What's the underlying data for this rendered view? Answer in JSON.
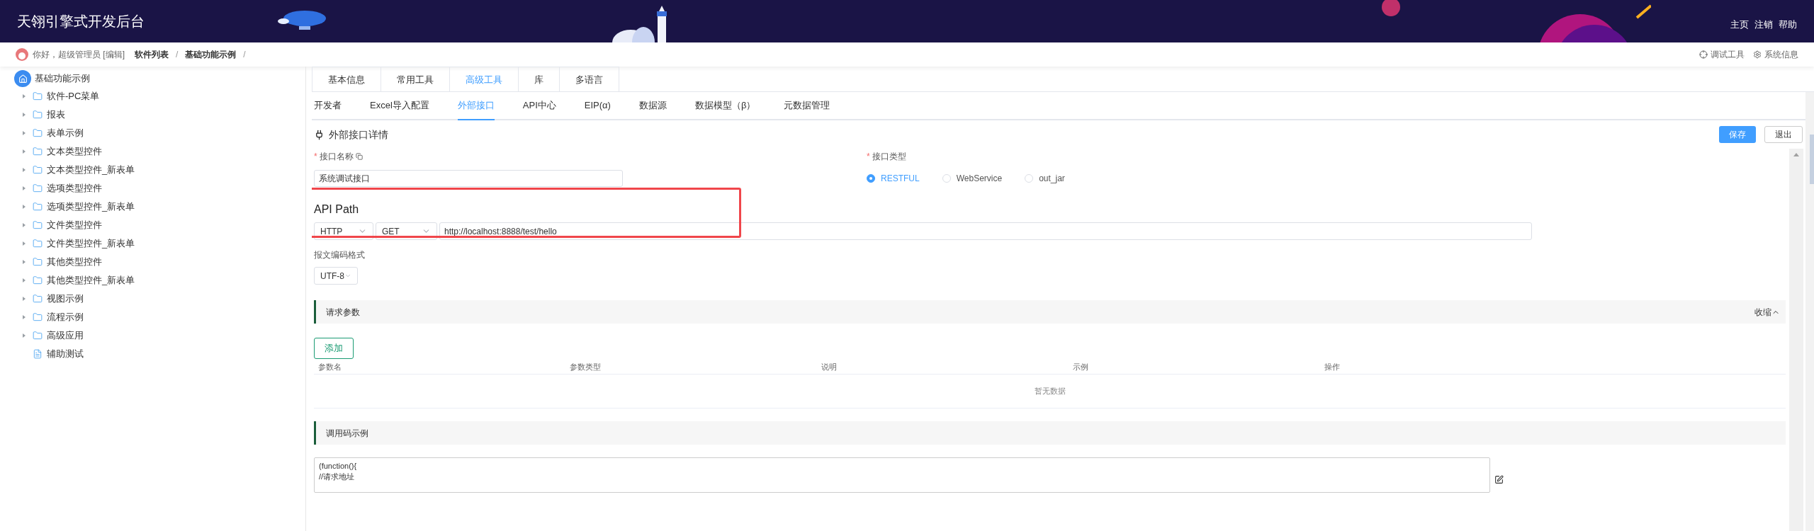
{
  "header": {
    "title": "天翎引擎式开发后台",
    "links": [
      "主页",
      "注销",
      "帮助"
    ]
  },
  "breadcrumb": {
    "greeting": "你好，超级管理员 [编辑]",
    "path": [
      {
        "label": "软件列表",
        "separator": "/"
      },
      {
        "label": "基础功能示例",
        "separator": "/"
      }
    ],
    "tools": [
      {
        "kind": "debug",
        "label": "调试工具"
      },
      {
        "kind": "settings",
        "label": "系统信息"
      }
    ]
  },
  "sidebar": {
    "root": {
      "label": "基础功能示例",
      "children": [
        {
          "kind": "folder",
          "label": "软件-PC菜单",
          "expanded": false
        },
        {
          "kind": "folder",
          "label": "报表",
          "expanded": false
        },
        {
          "kind": "folder",
          "label": "表单示例",
          "expanded": false
        },
        {
          "kind": "folder",
          "label": "文本类型控件",
          "expanded": false
        },
        {
          "kind": "folder",
          "label": "文本类型控件_新表单",
          "expanded": false
        },
        {
          "kind": "folder",
          "label": "选项类型控件",
          "expanded": false
        },
        {
          "kind": "folder",
          "label": "选项类型控件_新表单",
          "expanded": false
        },
        {
          "kind": "folder",
          "label": "文件类型控件",
          "expanded": false
        },
        {
          "kind": "folder",
          "label": "文件类型控件_新表单",
          "expanded": false
        },
        {
          "kind": "folder",
          "label": "其他类型控件",
          "expanded": false
        },
        {
          "kind": "folder",
          "label": "其他类型控件_新表单",
          "expanded": false
        },
        {
          "kind": "folder",
          "label": "视图示例",
          "expanded": false
        },
        {
          "kind": "folder",
          "label": "流程示例",
          "expanded": false
        },
        {
          "kind": "folder",
          "label": "高级应用",
          "expanded": false
        },
        {
          "kind": "file",
          "label": "辅助测试"
        }
      ]
    }
  },
  "tabs": [
    {
      "label": "基本信息",
      "selected": false
    },
    {
      "label": "常用工具",
      "selected": false
    },
    {
      "label": "高级工具",
      "selected": true
    },
    {
      "label": "库",
      "selected": false
    },
    {
      "label": "多语言",
      "selected": false
    }
  ],
  "subtabs": [
    {
      "label": "开发者",
      "selected": false
    },
    {
      "label": "Excel导入配置",
      "selected": false
    },
    {
      "label": "外部接口",
      "selected": true
    },
    {
      "label": "API中心",
      "selected": false
    },
    {
      "label": "EIP(α)",
      "selected": false
    },
    {
      "label": "数据源",
      "selected": false
    },
    {
      "label": "数据模型（β）",
      "selected": false
    },
    {
      "label": "元数据管理",
      "selected": false
    }
  ],
  "section": {
    "title": "外部接口详情",
    "buttons": [
      {
        "label": "保存",
        "kind": "primary"
      },
      {
        "label": "退出",
        "kind": "default"
      }
    ]
  },
  "form": {
    "name_field": {
      "label": "接口名称",
      "required_mark": "*",
      "value": "系统调试接口"
    },
    "type_field": {
      "label": "接口类型",
      "required_mark": "*",
      "options": [
        {
          "label": "RESTFUL",
          "selected": true
        },
        {
          "label": "WebService",
          "selected": false
        },
        {
          "label": "out_jar",
          "selected": false
        }
      ]
    },
    "api_path": {
      "title": "API Path",
      "protocol": "HTTP",
      "method": "GET",
      "url": "http://localhost:8888/test/hello"
    },
    "encoding": {
      "label": "报文编码格式",
      "value": "UTF-8"
    }
  },
  "request_params": {
    "title": "请求参数",
    "collapse_label": "收缩",
    "add_button": "添加",
    "columns": [
      "参数名",
      "参数类型",
      "说明",
      "示例",
      "操作"
    ],
    "empty_text": "暂无数据"
  },
  "code_example": {
    "title": "调用码示例",
    "lines": [
      "(function(){",
      "//请求地址"
    ]
  }
}
